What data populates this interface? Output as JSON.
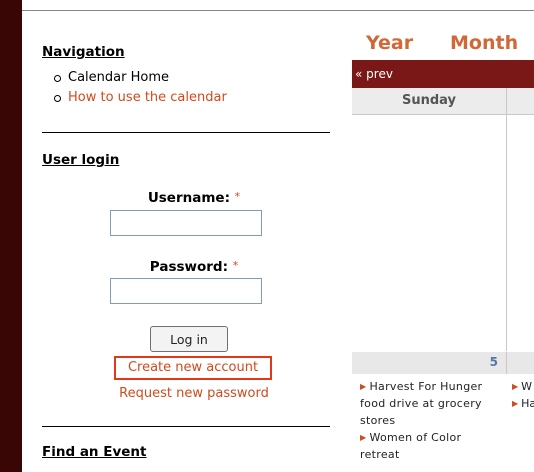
{
  "navigation": {
    "title": "Navigation",
    "items": [
      {
        "label": "Calendar Home"
      },
      {
        "label": "How to use the calendar"
      }
    ]
  },
  "user_login": {
    "title": "User login",
    "username_label": "Username:",
    "password_label": "Password:",
    "required_mark": "*",
    "username_value": "",
    "password_value": "",
    "login_button": "Log in",
    "create_account": "Create new account",
    "request_password": "Request new password"
  },
  "find_event": {
    "title": "Find an Event"
  },
  "calendar": {
    "tabs": [
      "Year",
      "Month"
    ],
    "prev_label": "« prev",
    "day_header": "Sunday",
    "day_number": "5",
    "events": [
      "Harvest For Hunger food drive at grocery stores",
      "Women of Color retreat"
    ],
    "next_col_events": [
      "W retr",
      "Ha Hun at g"
    ]
  },
  "colors": {
    "link": "#d04a1c",
    "highlight_border": "#e03818",
    "calendar_bar": "#7a1818",
    "left_bar": "#3a0505"
  }
}
